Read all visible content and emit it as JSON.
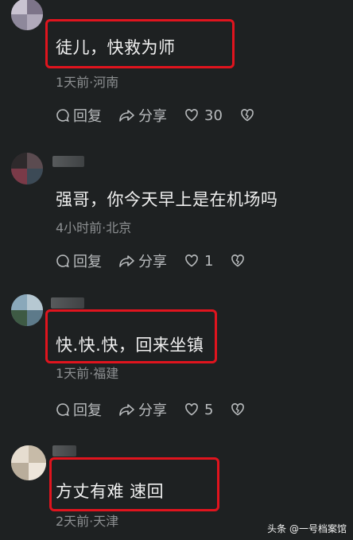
{
  "comments": [
    {
      "text": "徒儿，快救为师",
      "meta": "1天前·河南",
      "reply_label": "回复",
      "share_label": "分享",
      "like_count": "30"
    },
    {
      "text": "强哥，你今天早上是在机场吗",
      "meta": "4小时前·北京",
      "reply_label": "回复",
      "share_label": "分享",
      "like_count": "1"
    },
    {
      "text": "快.快.快，回来坐镇",
      "meta": "1天前·福建",
      "reply_label": "回复",
      "share_label": "分享",
      "like_count": "5"
    },
    {
      "text": "方丈有难 速回",
      "meta": "2天前·天津"
    }
  ],
  "watermark": "头条 @一号档案馆",
  "colors": {
    "background": "#1e2122",
    "highlight": "#e0141e",
    "meta": "#8c8f91"
  }
}
